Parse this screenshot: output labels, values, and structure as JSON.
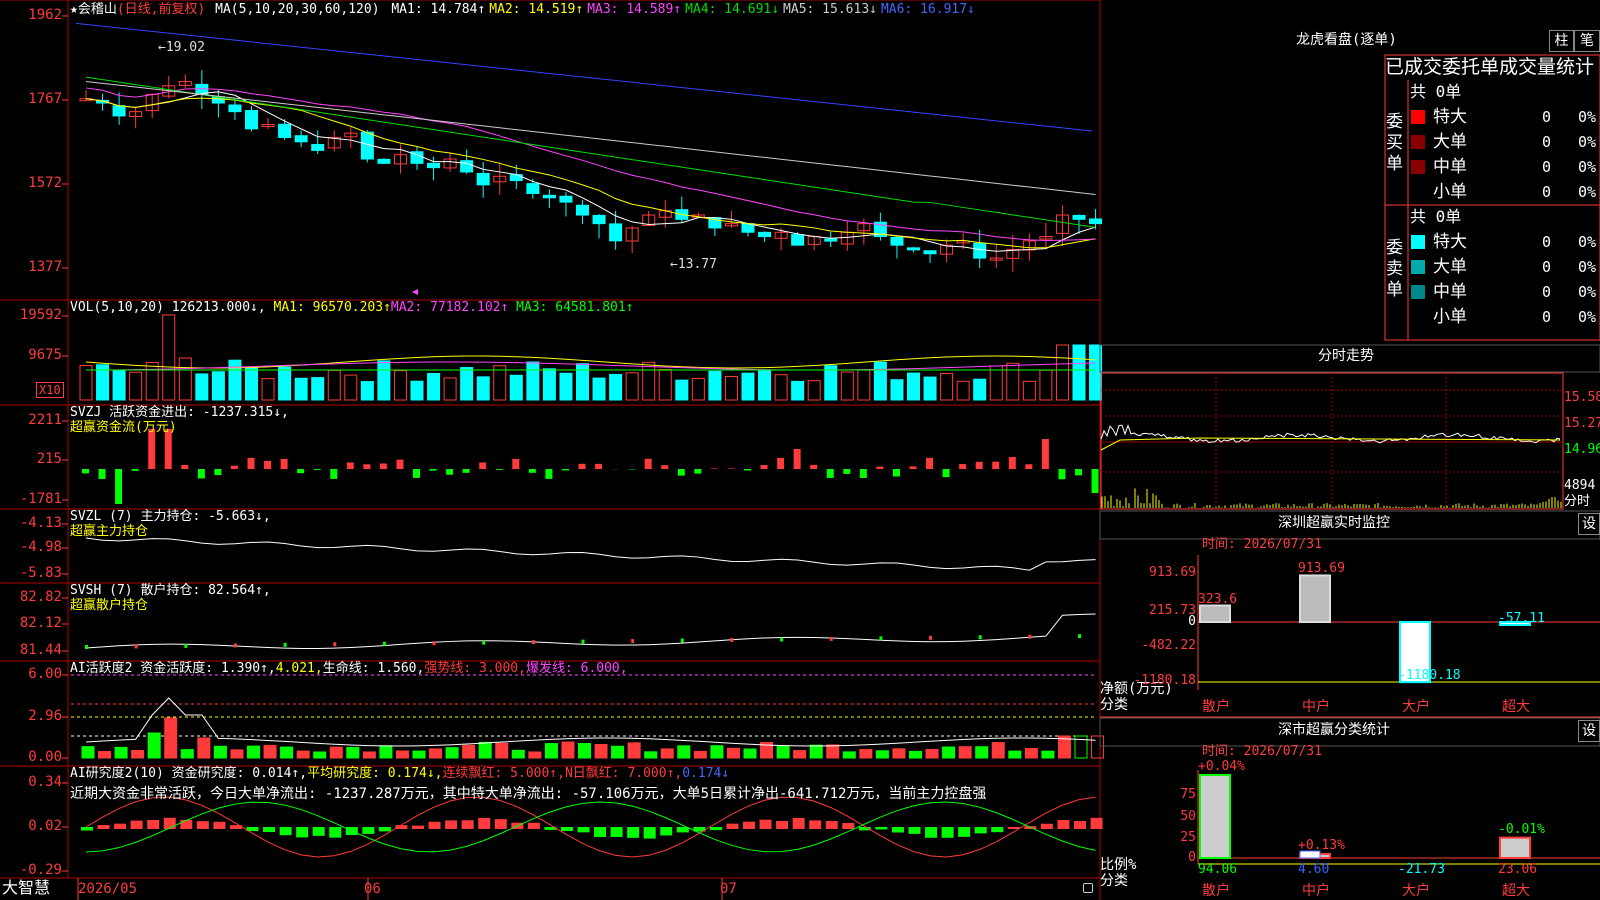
{
  "header": {
    "star": "★",
    "stock": "会稽山",
    "period": "(日线,前复权)",
    "ma_label": "MA(5,10,20,30,60,120)",
    "items": [
      {
        "text": "MA1: 14.784↑",
        "color": "#ffffff"
      },
      {
        "text": "MA2: 14.519↑",
        "color": "#ffff00"
      },
      {
        "text": "MA3: 14.589↑",
        "color": "#ff44ff"
      },
      {
        "text": "MA4: 14.691↓",
        "color": "#00dd00"
      },
      {
        "text": "MA5: 15.613↓",
        "color": "#cccccc"
      },
      {
        "text": "MA6: 16.917↓",
        "color": "#4466ff"
      }
    ]
  },
  "price_axis": [
    "1962",
    "1767",
    "1572",
    "1377"
  ],
  "price_marks": {
    "high": "←19.02",
    "low": "←13.77"
  },
  "vol": {
    "title": "VOL(5,10,20)",
    "value": "126213.000↓,",
    "ma1": "MA1: 96570.203↑",
    "ma2": "MA2: 77182.102↑",
    "ma3": "MA3: 64581.801↑",
    "axis": [
      "19592",
      "9675"
    ],
    "unit": "X10"
  },
  "svzj": {
    "title": "SVZJ  活跃资金进出: -1237.315↓,",
    "sub": "超赢资金流(万元)",
    "axis": [
      "2211",
      "215",
      "-1781"
    ]
  },
  "svzl": {
    "title": "SVZL (7) 主力持仓: -5.663↓,",
    "sub": "超赢主力持仓",
    "axis": [
      "-4.13",
      "-4.98",
      "-5.83"
    ]
  },
  "svsh": {
    "title": "SVSH (7) 散户持仓: 82.564↑,",
    "sub": "超赢散户持仓",
    "axis": [
      "82.82",
      "82.12",
      "81.44"
    ]
  },
  "ai1": {
    "t1": "AI活跃度2 资金活跃度: 1.390↑,",
    "t2": "4.021,",
    "t3": "生命线: 1.560,",
    "t4": "强势线: 3.000,",
    "t5": "爆发线: 6.000,",
    "axis": [
      "6.00",
      "2.96",
      "0.00"
    ]
  },
  "ai2": {
    "title": "AI研究度2(10) 资金研究度: 0.014↑,",
    "avg": "平均研究度: 0.174↓,",
    "lx": "连续飘红: 5.000↑,",
    "nr": "N日飘红: 7.000↑,",
    "last": "0.174↓",
    "comment": "近期大资金非常活跃，今日大单净流出: -1237.287万元，其中特大单净流出: -57.106万元，大单5日累计净出-641.712万元，当前主力控盘强",
    "axis": [
      "0.34",
      "0.02",
      "-0.29"
    ]
  },
  "dates": [
    "2026/05",
    "06",
    "07"
  ],
  "brand": "大智慧",
  "right": {
    "lhb_title": "龙虎看盘(逐单)",
    "btn_zhu": "柱",
    "btn_bi": "笔",
    "stat_title": "已成交委托单成交量统计",
    "buy_label": "委买单",
    "sell_label": "委卖单",
    "total": "共 0单",
    "rows": [
      {
        "name": "特大",
        "v": "0",
        "p": "0%"
      },
      {
        "name": "大单",
        "v": "0",
        "p": "0%"
      },
      {
        "name": "中单",
        "v": "0",
        "p": "0%"
      },
      {
        "name": "小单",
        "v": "0",
        "p": "0%"
      }
    ],
    "fenshi": {
      "title": "分时走势",
      "axis": [
        "15.58",
        "15.27",
        "14.96",
        "4894"
      ],
      "unit": "分时"
    },
    "monitor": {
      "title": "深圳超赢实时监控",
      "btn": "设",
      "time": "时间: 2026/07/31",
      "axis": [
        "913.69",
        "215.73",
        "0",
        "-482.22",
        "-1180.18"
      ],
      "ylabel": "净额(万元)",
      "xlabel": "分类",
      "cats": [
        "散户",
        "中户",
        "大户",
        "超大"
      ],
      "vals": [
        "323.6",
        "913.69",
        "-1180.18",
        "-57.11"
      ]
    },
    "classify": {
      "title": "深市超赢分类统计",
      "btn": "设",
      "time": "时间: 2026/07/31",
      "axis": [
        "75",
        "50",
        "25",
        "0"
      ],
      "ylabel": "比例%",
      "xlabel": "分类",
      "cats": [
        "散户",
        "中户",
        "大户",
        "超大"
      ],
      "tops": [
        "+0.04%",
        "+0.13%",
        "",
        "-0.01%"
      ],
      "bottoms": [
        "94.06",
        "4.60",
        "-21.73",
        "23.06"
      ]
    }
  }
}
